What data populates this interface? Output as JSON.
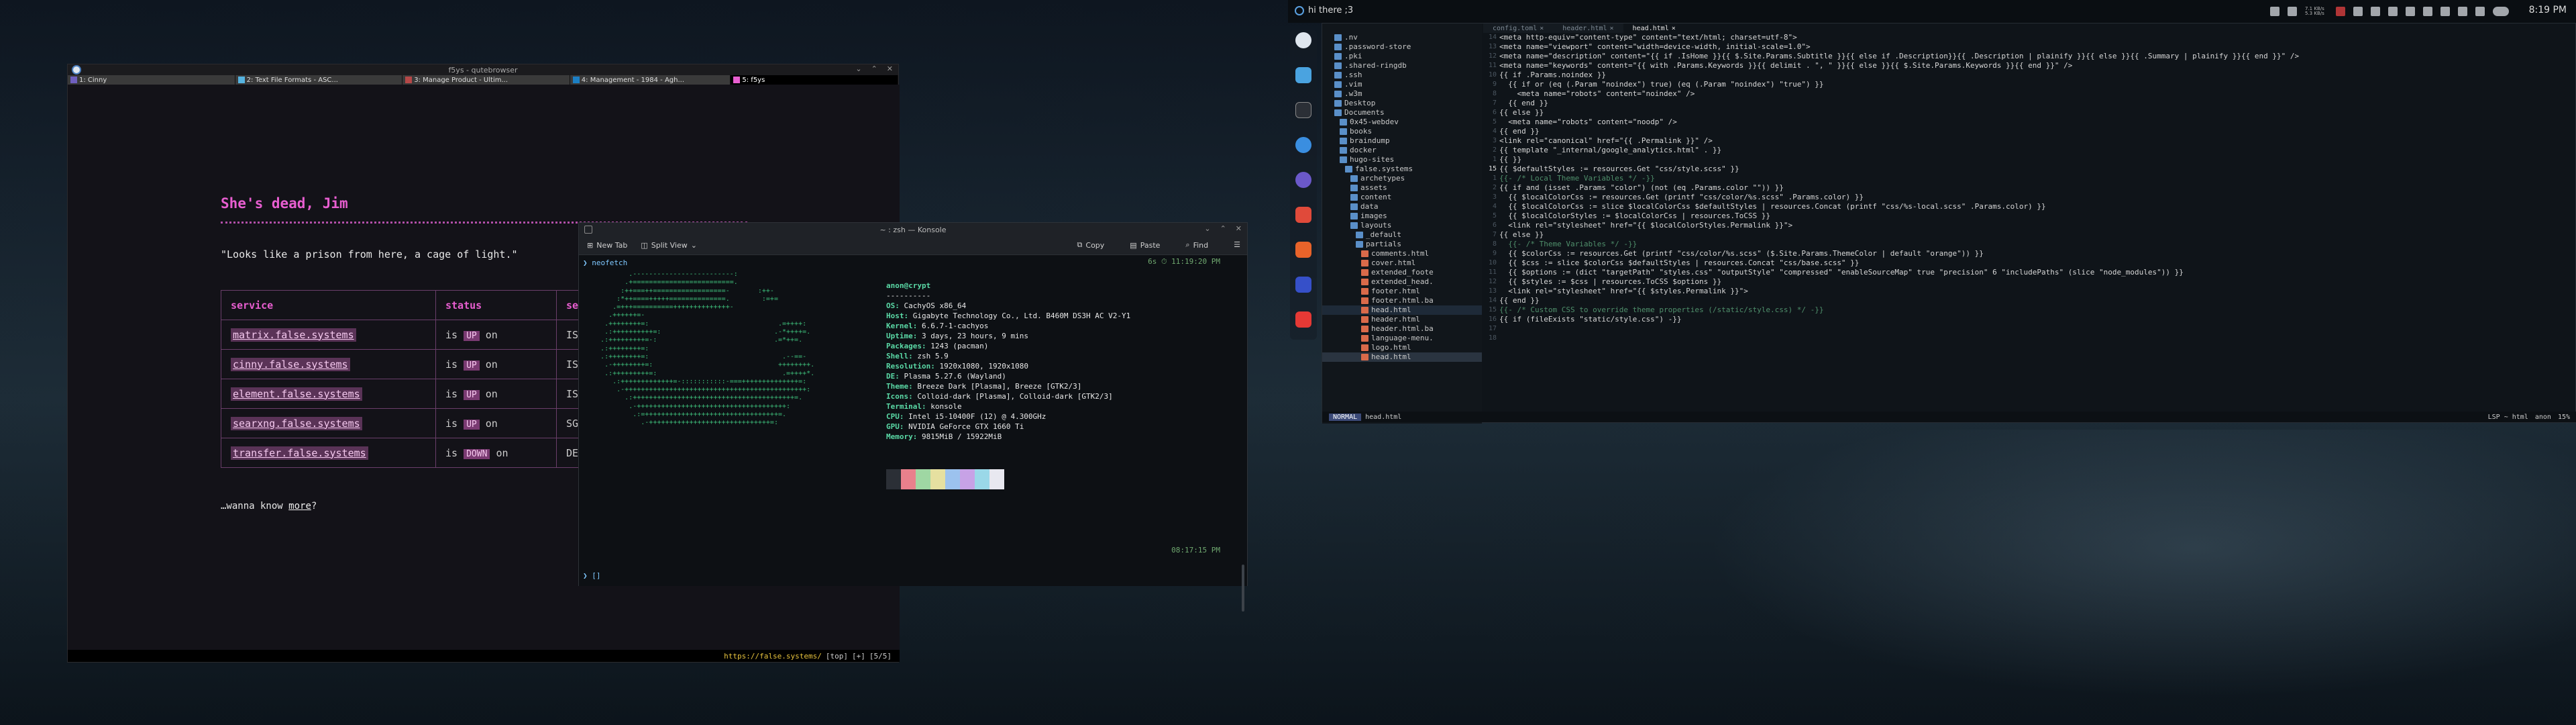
{
  "browser": {
    "window_title": "f5ys - qutebrowser",
    "tabs": [
      {
        "label": "1: Cinny",
        "color": "#6f5fbf"
      },
      {
        "label": "2: Text File Formats - ASC...",
        "color": "#56b3e0"
      },
      {
        "label": "3: Manage Product - Ultim...",
        "color": "#b54848"
      },
      {
        "label": "4: Management - 1984 - Agh...",
        "color": "#1c7fc4"
      },
      {
        "label": "5: f5ys",
        "color": "#e85ed0"
      }
    ],
    "heading": "She's dead, Jim",
    "quote": "\"Looks like a prison from here, a cage of light.\"",
    "table": {
      "headers": [
        "service",
        "status",
        "se"
      ],
      "rows": [
        {
          "service": "matrix.false.systems",
          "is": "is",
          "status": "UP",
          "on": "on",
          "third": "IS"
        },
        {
          "service": "cinny.false.systems",
          "is": "is",
          "status": "UP",
          "on": "on",
          "third": "IS"
        },
        {
          "service": "element.false.systems",
          "is": "is",
          "status": "UP",
          "on": "on",
          "third": "IS"
        },
        {
          "service": "searxng.false.systems",
          "is": "is",
          "status": "UP",
          "on": "on",
          "third": "SG"
        },
        {
          "service": "transfer.false.systems",
          "is": "is",
          "status": "DOWN",
          "on": "on",
          "third": "DE"
        }
      ]
    },
    "more_prefix": "…wanna know ",
    "more_link": "more",
    "more_suffix": "?",
    "status_url": "https://false.systems/",
    "status_pos": "[top]",
    "status_mid": "[+]",
    "status_count": "[5/5]"
  },
  "konsole": {
    "title": "~ : zsh — Konsole",
    "toolbar": {
      "new_tab": "New Tab",
      "split_view": "Split View",
      "copy": "Copy",
      "paste": "Paste",
      "find": "Find"
    },
    "prompt_cmd": "❯ neofetch",
    "time1": "6s ⏱ 11:19:20 PM",
    "time2": "08:17:15 PM",
    "user_host": "anon@crypt",
    "separator": "----------",
    "info": [
      {
        "k": "OS",
        "v": "CachyOS x86_64"
      },
      {
        "k": "Host",
        "v": "Gigabyte Technology Co., Ltd. B460M DS3H AC V2-Y1"
      },
      {
        "k": "Kernel",
        "v": "6.6.7-1-cachyos"
      },
      {
        "k": "Uptime",
        "v": "3 days, 23 hours, 9 mins"
      },
      {
        "k": "Packages",
        "v": "1243 (pacman)"
      },
      {
        "k": "Shell",
        "v": "zsh 5.9"
      },
      {
        "k": "Resolution",
        "v": "1920x1080, 1920x1080"
      },
      {
        "k": "DE",
        "v": "Plasma 5.27.6 (Wayland)"
      },
      {
        "k": "Theme",
        "v": "Breeze Dark [Plasma], Breeze [GTK2/3]"
      },
      {
        "k": "Icons",
        "v": "Colloid-dark [Plasma], Colloid-dark [GTK2/3]"
      },
      {
        "k": "Terminal",
        "v": "konsole"
      },
      {
        "k": "CPU",
        "v": "Intel i5-10400F (12) @ 4.300GHz"
      },
      {
        "k": "GPU",
        "v": "NVIDIA GeForce GTX 1660 Ti"
      },
      {
        "k": "Memory",
        "v": "9815MiB / 15922MiB"
      }
    ],
    "swatches": [
      "#2b2f36",
      "#e8808c",
      "#9fd7a3",
      "#e6e0a0",
      "#9cc2ee",
      "#c7a2e6",
      "#9ad8e8",
      "#e8e8f0"
    ],
    "prompt2": "❯ []"
  },
  "topbar": {
    "workspace_label": "hi there ;3",
    "clock": "8:19 PM",
    "net_up": "7.1 KB/s",
    "net_down": "5.3 KB/s"
  },
  "editor": {
    "tabs": [
      "config.toml",
      "header.html",
      "head.html"
    ],
    "tree": [
      {
        "name": ".nv",
        "type": "dir"
      },
      {
        "name": ".password-store",
        "type": "dir"
      },
      {
        "name": ".pki",
        "type": "dir"
      },
      {
        "name": ".shared-ringdb",
        "type": "dir"
      },
      {
        "name": ".ssh",
        "type": "dir"
      },
      {
        "name": ".vim",
        "type": "dir"
      },
      {
        "name": ".w3m",
        "type": "dir"
      },
      {
        "name": "Desktop",
        "type": "dir"
      },
      {
        "name": "Documents",
        "type": "dir"
      },
      {
        "name": "0x45-webdev",
        "type": "dir"
      },
      {
        "name": "books",
        "type": "dir"
      },
      {
        "name": "braindump",
        "type": "dir"
      },
      {
        "name": "docker",
        "type": "dir"
      },
      {
        "name": "hugo-sites",
        "type": "dir"
      },
      {
        "name": "false.systems",
        "type": "dir"
      },
      {
        "name": "archetypes",
        "type": "dir"
      },
      {
        "name": "assets",
        "type": "dir"
      },
      {
        "name": "content",
        "type": "dir"
      },
      {
        "name": "data",
        "type": "dir"
      },
      {
        "name": "images",
        "type": "dir"
      },
      {
        "name": "layouts",
        "type": "dir"
      },
      {
        "name": "_default",
        "type": "dir"
      },
      {
        "name": "partials",
        "type": "dir"
      },
      {
        "name": "comments.html",
        "type": "file"
      },
      {
        "name": "cover.html",
        "type": "file"
      },
      {
        "name": "extended_foote",
        "type": "file"
      },
      {
        "name": "extended_head.",
        "type": "file"
      },
      {
        "name": "footer.html",
        "type": "file"
      },
      {
        "name": "footer.html.ba",
        "type": "file"
      },
      {
        "name": "head.html",
        "type": "file"
      },
      {
        "name": "header.html",
        "type": "file"
      },
      {
        "name": "header.html.ba",
        "type": "file"
      },
      {
        "name": "language-menu.",
        "type": "file"
      },
      {
        "name": "logo.html",
        "type": "file"
      },
      {
        "name": "head.html",
        "type": "file"
      }
    ],
    "lines": [
      "<meta http-equiv=\"content-type\" content=\"text/html; charset=utf-8\">",
      "<meta name=\"viewport\" content=\"width=device-width, initial-scale=1.0\">",
      "<meta name=\"description\" content=\"{{ if .IsHome }}{{ $.Site.Params.Subtitle }}{{ else if .Description}}{{ .Description | plainify }}{{ else }}{{ .Summary | plainify }}{{ end }}\" />",
      "<meta name=\"keywords\" content=\"{{ with .Params.Keywords }}{{ delimit . \", \" }}{{ else }}{{ $.Site.Params.Keywords }}{{ end }}\" />",
      "{{ if .Params.noindex }}",
      "  {{ if or (eq (.Param \"noindex\") true) (eq (.Param \"noindex\") \"true\") }}",
      "    <meta name=\"robots\" content=\"noindex\" />",
      "  {{ end }}",
      "{{ else }}",
      "  <meta name=\"robots\" content=\"noodp\" />",
      "{{ end }}",
      "<link rel=\"canonical\" href=\"{{ .Permalink }}\" />",
      "",
      "{{ template \"_internal/google_analytics.html\" . }}",
      "{{ }}",
      "{{ $defaultStyles := resources.Get \"css/style.scss\" }}",
      "{{- /* Local Theme Variables */ -}}",
      "{{ if and (isset .Params \"color\") (not (eq .Params.color \"\")) }}",
      "  {{ $localColorCss := resources.Get (printf \"css/color/%s.scss\" .Params.color) }}",
      "  {{ $localColorCss := slice $localColorCss $defaultStyles | resources.Concat (printf \"css/%s-local.scss\" .Params.color) }}",
      "  {{ $localColorStyles := $localColorCss | resources.ToCSS }}",
      "  <link rel=\"stylesheet\" href=\"{{ $localColorStyles.Permalink }}\">",
      "{{ else }}",
      "  {{- /* Theme Variables */ -}}",
      "  {{ $colorCss := resources.Get (printf \"css/color/%s.scss\" ($.Site.Params.ThemeColor | default \"orange\")) }}",
      "  {{ $css := slice $colorCss $defaultStyles | resources.Concat \"css/base.scss\" }}",
      "  {{ $options := (dict \"targetPath\" \"styles.css\" \"outputStyle\" \"compressed\" \"enableSourceMap\" true \"precision\" 6 \"includePaths\" (slice \"node_modules\")) }}",
      "  {{ $styles := $css | resources.ToCSS $options }}",
      "  <link rel=\"stylesheet\" href=\"{{ $styles.Permalink }}\">",
      "{{ end }}",
      "",
      "{{- /* Custom CSS to override theme properties (/static/style.css) */ -}}",
      "{{ if (fileExists \"static/style.css\") -}}"
    ],
    "status_mode": "NORMAL",
    "status_file": "head.html",
    "status_lsp": "LSP ~ html",
    "status_user": "anon",
    "status_pct": "15%"
  }
}
